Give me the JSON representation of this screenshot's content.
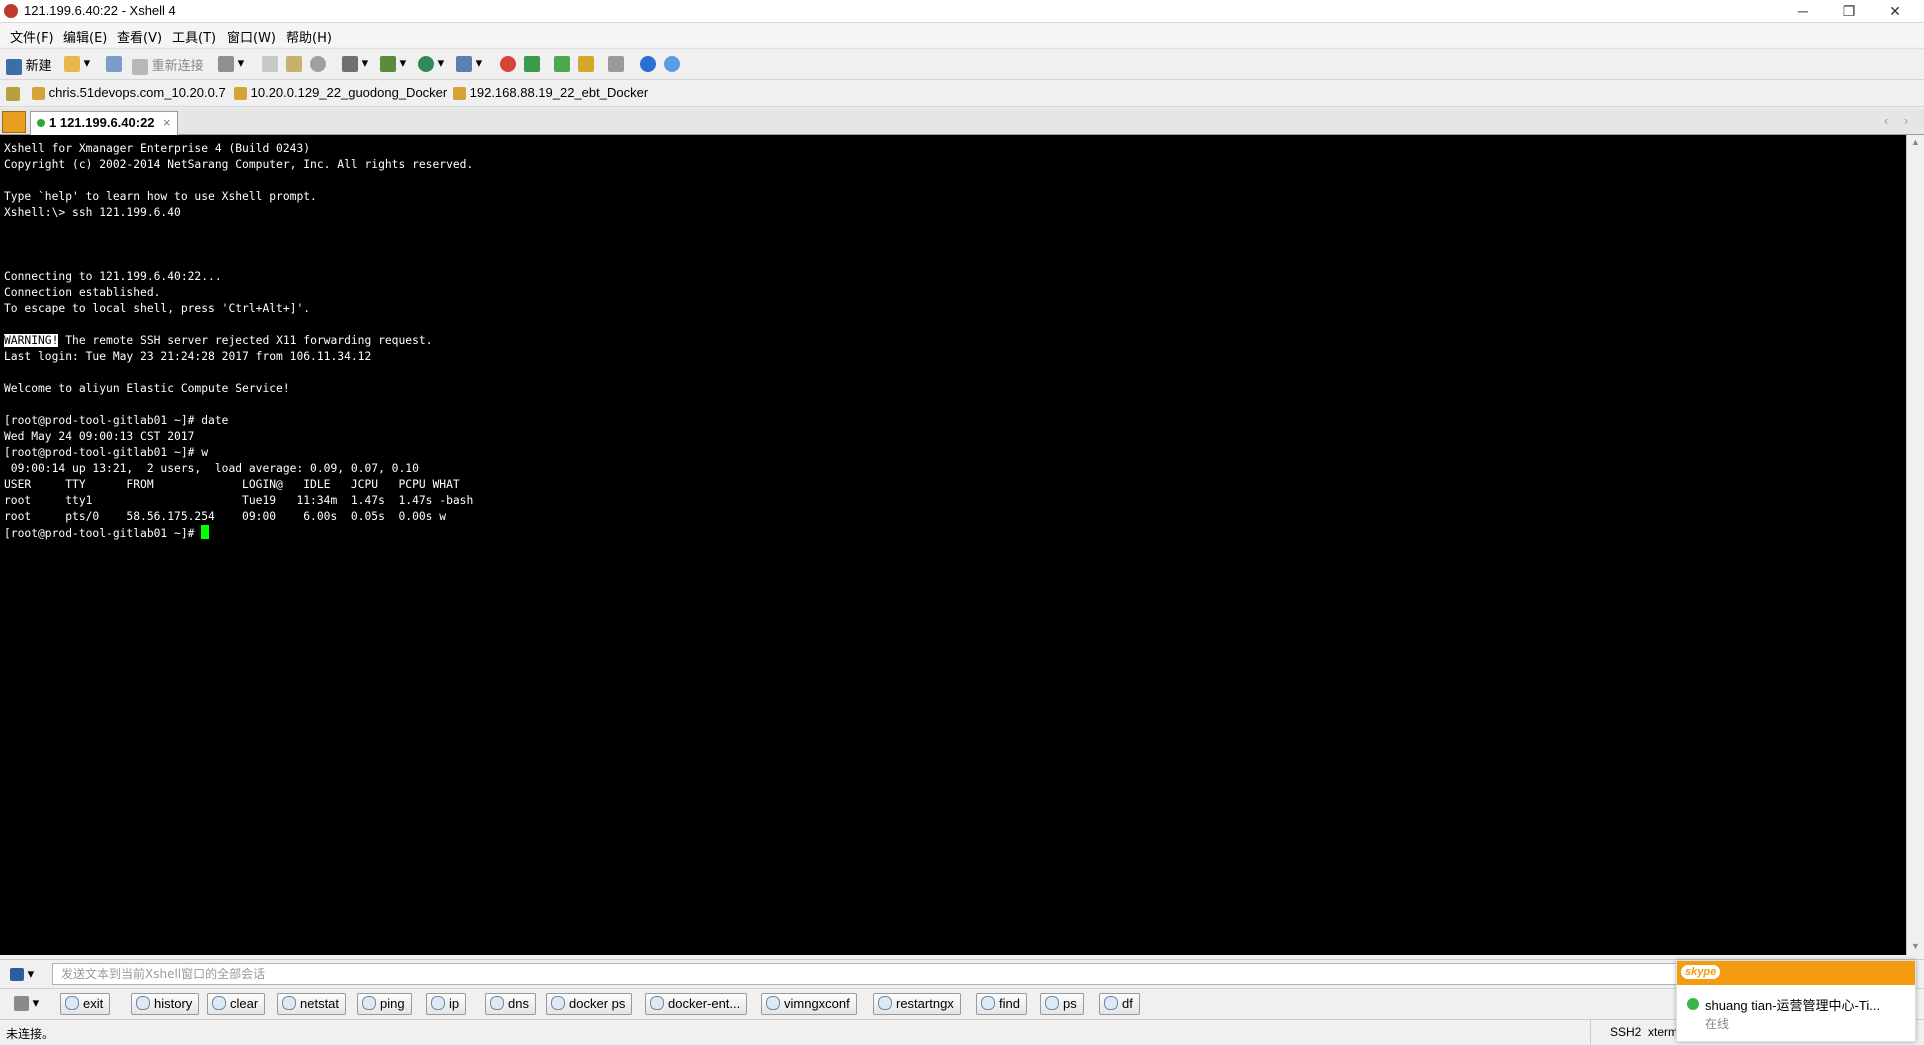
{
  "window": {
    "title": "121.199.6.40:22 - Xshell 4",
    "minimize": "─",
    "restore": "❐",
    "close": "✕"
  },
  "menu": [
    "文件(F)",
    "编辑(E)",
    "查看(V)",
    "工具(T)",
    "窗口(W)",
    "帮助(H)"
  ],
  "toolbar": {
    "new_label": "新建",
    "reconnect_label": "重新连接"
  },
  "links": [
    "chris.51devops.com_10.20.0.7",
    "10.20.0.129_22_guodong_Docker",
    "192.168.88.19_22_ebt_Docker"
  ],
  "tab": {
    "label": "1 121.199.6.40:22",
    "close": "×"
  },
  "terminal": {
    "lines_before_warning": "Xshell for Xmanager Enterprise 4 (Build 0243)\nCopyright (c) 2002-2014 NetSarang Computer, Inc. All rights reserved.\n\nType `help' to learn how to use Xshell prompt.\nXshell:\\> ssh 121.199.6.40\n\n\n\nConnecting to 121.199.6.40:22...\nConnection established.\nTo escape to local shell, press 'Ctrl+Alt+]'.\n\n",
    "warning_tag": "WARNING!",
    "warning_text": " The remote SSH server rejected X11 forwarding request.",
    "lines_after_warning": "\nLast login: Tue May 23 21:24:28 2017 from 106.11.34.12\n\nWelcome to aliyun Elastic Compute Service!\n\n[root@prod-tool-gitlab01 ~]# date\nWed May 24 09:00:13 CST 2017\n[root@prod-tool-gitlab01 ~]# w\n 09:00:14 up 13:21,  2 users,  load average: 0.09, 0.07, 0.10\nUSER     TTY      FROM             LOGIN@   IDLE   JCPU   PCPU WHAT\nroot     tty1                      Tue19   11:34m  1.47s  1.47s -bash\nroot     pts/0    58.56.175.254    09:00    6.00s  0.05s  0.00s w\n",
    "prompt": "[root@prod-tool-gitlab01 ~]# "
  },
  "compose": {
    "placeholder": "发送文本到当前Xshell窗口的全部会话"
  },
  "quick_commands": [
    "exit",
    "history",
    "clear",
    "netstat",
    "ping",
    "ip",
    "dns",
    "docker ps",
    "docker-ent...",
    "vimngxconf",
    "restartngx",
    "find",
    "ps",
    "df"
  ],
  "status": {
    "left": "未连接。",
    "protocol": "SSH2",
    "terminal": "xterm"
  },
  "skype": {
    "brand": "skype",
    "contact": "shuang tian-运营管理中心-Ti...",
    "presence": "在线"
  },
  "colors": {
    "terminal_bg": "#000000",
    "terminal_fg": "#ffffff",
    "cursor": "#00ff00",
    "skype_orange": "#f39c12"
  }
}
